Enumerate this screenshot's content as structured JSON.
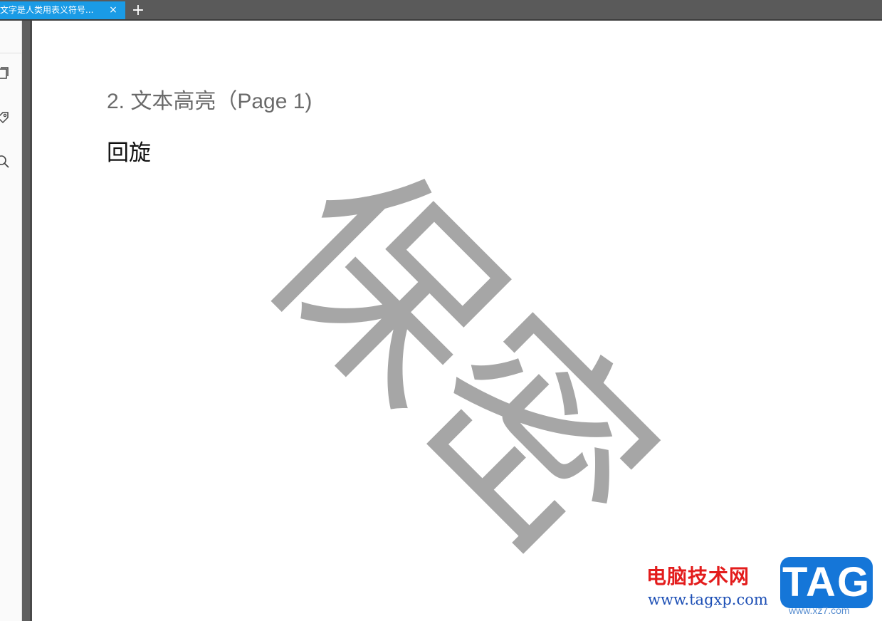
{
  "tabs": [
    {
      "label": "文字是人类用表义符号...",
      "close": "×",
      "active": true
    }
  ],
  "new_tab_label": "+",
  "sidebar": {
    "icons": [
      "page-icon",
      "tag-icon",
      "search-icon"
    ]
  },
  "document": {
    "section_heading": "2. 文本高亮（Page 1)",
    "body_text": "回旋",
    "watermark": "保密"
  },
  "overlay_logo": {
    "name": "电脑技术网",
    "url": "www.tagxp.com",
    "badge": "TAG",
    "sub": "www.xz7.com"
  },
  "colors": {
    "tab_active": "#1a9be6",
    "tabbar": "#5a5a5a",
    "watermark": "#a6a6a6",
    "logo_red": "#e31c1c",
    "logo_blue": "#1576d8"
  }
}
